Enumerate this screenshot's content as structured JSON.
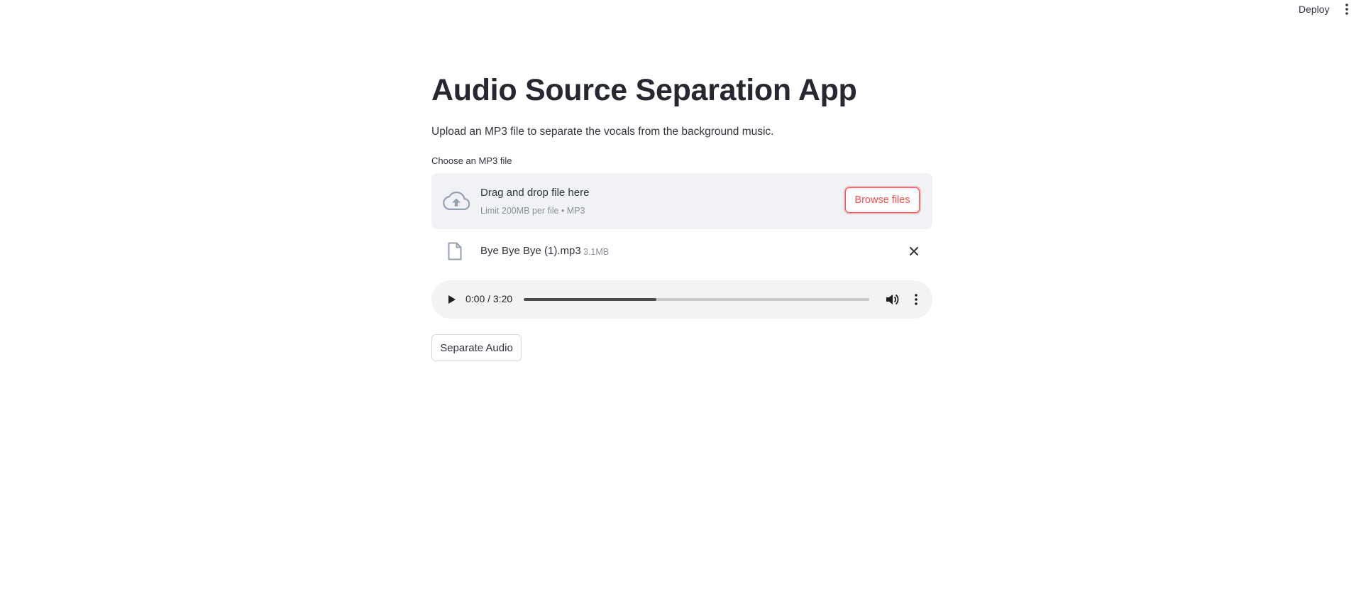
{
  "header": {
    "deploy_label": "Deploy",
    "menu_icon": "kebab-vertical-icon"
  },
  "main": {
    "title": "Audio Source Separation App",
    "subtitle": "Upload an MP3 file to separate the vocals from the background music.",
    "uploader": {
      "label": "Choose an MP3 file",
      "drop_text": "Drag and drop file here",
      "limit_text": "Limit 200MB per file • MP3",
      "browse_label": "Browse files",
      "icon": "cloud-upload-icon"
    },
    "uploaded_file": {
      "name": "Bye Bye Bye (1).mp3",
      "size": "3.1MB",
      "icon": "file-icon",
      "remove_icon": "close-icon"
    },
    "audio_player": {
      "time": "0:00 / 3:20",
      "buffered_fraction": 0.385
    },
    "separate_button_label": "Separate Audio"
  },
  "colors": {
    "accent": "#ff4b4b",
    "text": "#31333f",
    "muted": "#8d909a",
    "dropzone_bg": "#f0f2f6",
    "player_bg": "#f1f3f4"
  }
}
